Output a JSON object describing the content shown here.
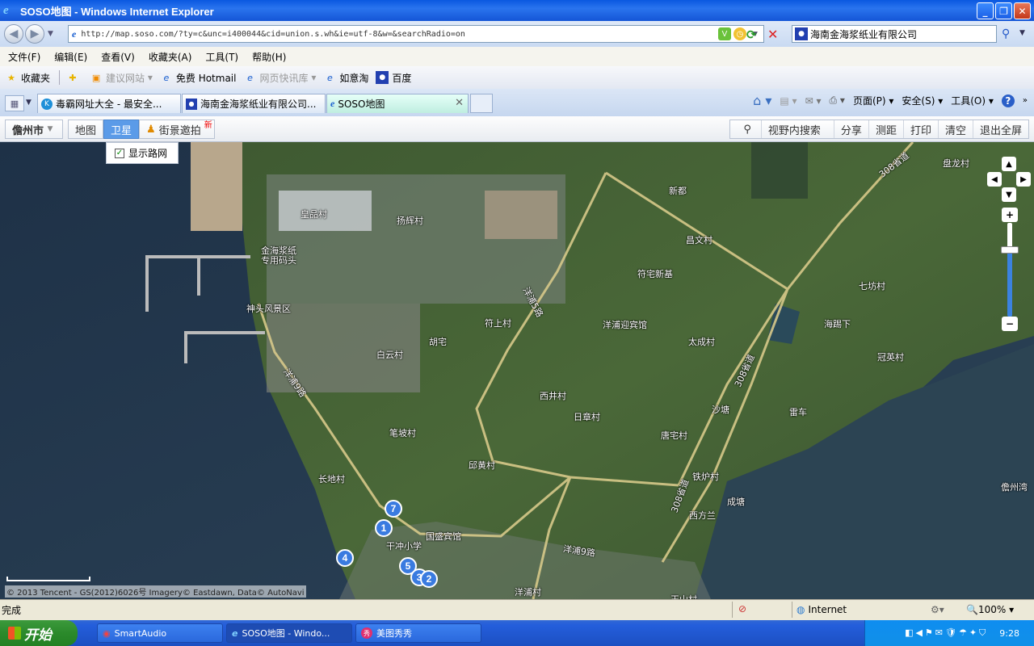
{
  "window": {
    "title": "SOSO地图 - Windows Internet Explorer",
    "controls": [
      "_",
      "❐",
      "✕"
    ]
  },
  "address": {
    "url": "http://map.soso.com/?ty=c&unc=i400044&cid=union.s.wh&ie=utf-8&w=&searchRadio=on",
    "search_value": "海南金海浆纸业有限公司"
  },
  "menu": [
    "文件(F)",
    "编辑(E)",
    "查看(V)",
    "收藏夹(A)",
    "工具(T)",
    "帮助(H)"
  ],
  "favorites": {
    "label": "收藏夹",
    "items": [
      "建议网站",
      "免费 Hotmail",
      "网页快讯库",
      "如意淘",
      "百度"
    ]
  },
  "tabs": [
    "毒霸网址大全 - 最安全...",
    "海南金海浆纸业有限公司...",
    "SOSO地图"
  ],
  "commands": [
    "页面(P)",
    "安全(S)",
    "工具(O)"
  ],
  "map_toolbar": {
    "city": "儋州市",
    "map": "地图",
    "satellite": "卫星",
    "streetview": "街景邀拍",
    "new_badge": "新",
    "show_roads": "显示路网",
    "actions": [
      "视野内搜索",
      "分享",
      "测距",
      "打印",
      "清空",
      "退出全屏"
    ]
  },
  "map_labels": [
    {
      "text": "皇品村"
    },
    {
      "text": "扬辉村"
    },
    {
      "text": "金海浆纸"
    },
    {
      "text": "专用码头"
    },
    {
      "text": "神头风景区"
    },
    {
      "text": "新都"
    },
    {
      "text": "昌文村"
    },
    {
      "text": "符宅新基"
    },
    {
      "text": "洋浦迎宾馆"
    },
    {
      "text": "太成村"
    },
    {
      "text": "符上村"
    },
    {
      "text": "胡宅"
    },
    {
      "text": "白云村"
    },
    {
      "text": "西井村"
    },
    {
      "text": "日章村"
    },
    {
      "text": "笔坡村"
    },
    {
      "text": "邱黄村"
    },
    {
      "text": "唐宅村"
    },
    {
      "text": "沙塘"
    },
    {
      "text": "雷车"
    },
    {
      "text": "长地村"
    },
    {
      "text": "铁炉村"
    },
    {
      "text": "成塘"
    },
    {
      "text": "西方兰"
    },
    {
      "text": "国盛宾馆"
    },
    {
      "text": "干冲小学"
    },
    {
      "text": "洋浦村"
    },
    {
      "text": "七坊村"
    },
    {
      "text": "海踢下"
    },
    {
      "text": "冠英村"
    },
    {
      "text": "盘龙村"
    },
    {
      "text": "儋州湾"
    },
    {
      "text": "王山村"
    },
    {
      "text": "洋浦5路"
    },
    {
      "text": "洋浦9路"
    },
    {
      "text": "洋浦9路"
    },
    {
      "text": "308省道"
    },
    {
      "text": "308省道"
    },
    {
      "text": "308省道"
    }
  ],
  "pins": [
    "7",
    "1",
    "4",
    "5",
    "3",
    "2"
  ],
  "copyright": "© 2013 Tencent - GS(2012)6026号 Imagery© Eastdawn, Data© AutoNavi",
  "status": {
    "text": "完成",
    "zone": "Internet",
    "zoom": "100%"
  },
  "taskbar": {
    "start": "开始",
    "tasks": [
      "SmartAudio",
      "SOSO地图 - Windo...",
      "美图秀秀"
    ],
    "clock": "9:28"
  }
}
